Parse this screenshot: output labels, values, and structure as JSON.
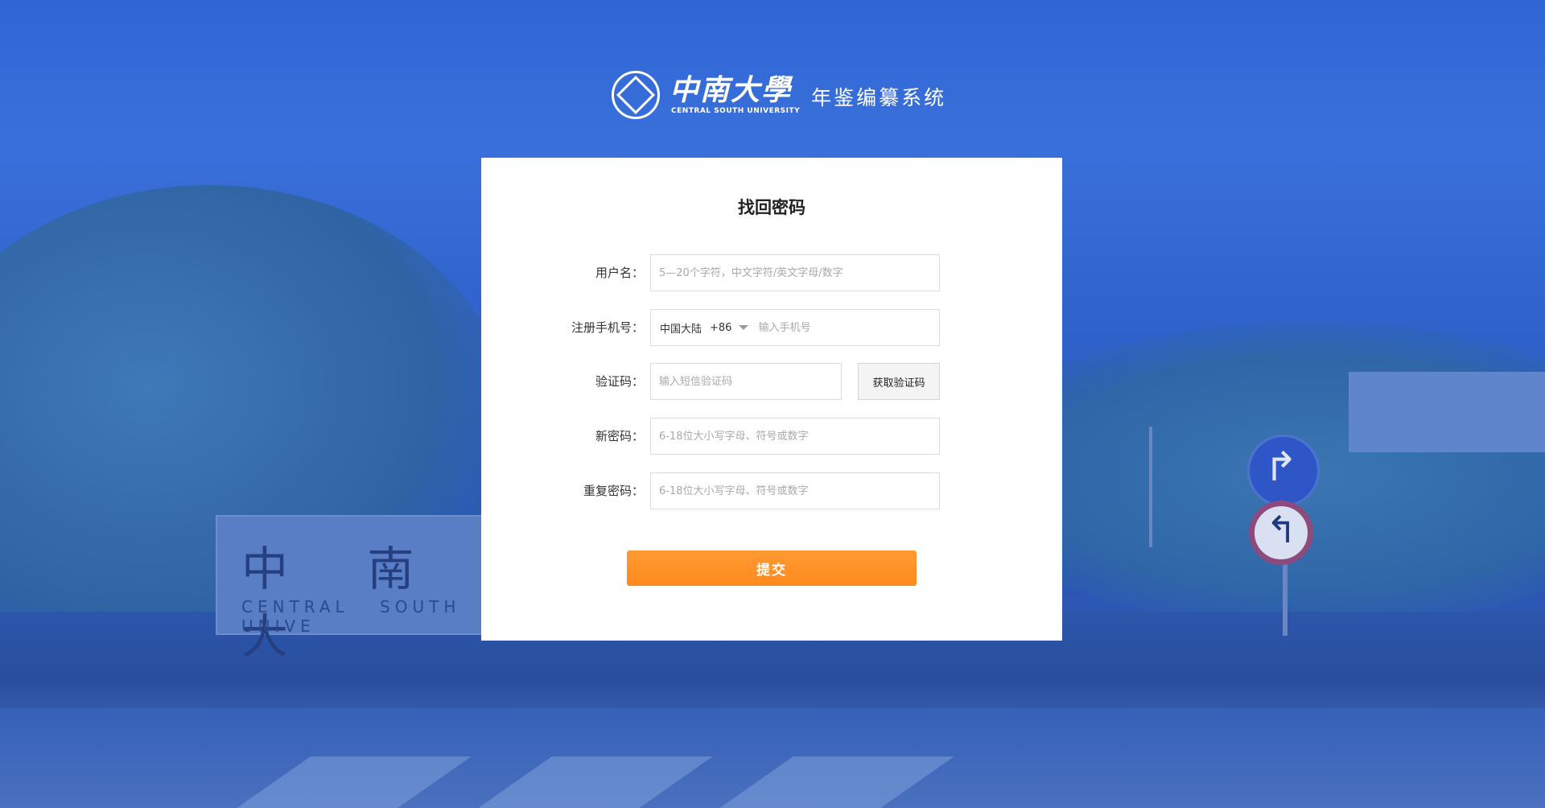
{
  "header": {
    "logo_cn": "中南大學",
    "logo_en": "CENTRAL SOUTH UNIVERSITY",
    "system_title": "年鉴编纂系统"
  },
  "background": {
    "sign_cn": "中 南 大",
    "sign_en": "CENTRAL SOUTH UNIVE"
  },
  "form": {
    "title": "找回密码",
    "username": {
      "label": "用户名：",
      "placeholder": "5—20个字符，中文字符/英文字母/数字"
    },
    "phone": {
      "label": "注册手机号：",
      "region": "中国大陆",
      "code": "+86",
      "placeholder": "输入手机号"
    },
    "verify": {
      "label": "验证码：",
      "placeholder": "输入短信验证码",
      "button": "获取验证码"
    },
    "new_password": {
      "label": "新密码：",
      "placeholder": "6-18位大小写字母、符号或数字"
    },
    "repeat_password": {
      "label": "重复密码：",
      "placeholder": "6-18位大小写字母、符号或数字"
    },
    "submit": "提交"
  },
  "colors": {
    "background_blue": "#2f66d4",
    "submit_orange": "#ff8a1c",
    "panel_white": "#ffffff"
  }
}
